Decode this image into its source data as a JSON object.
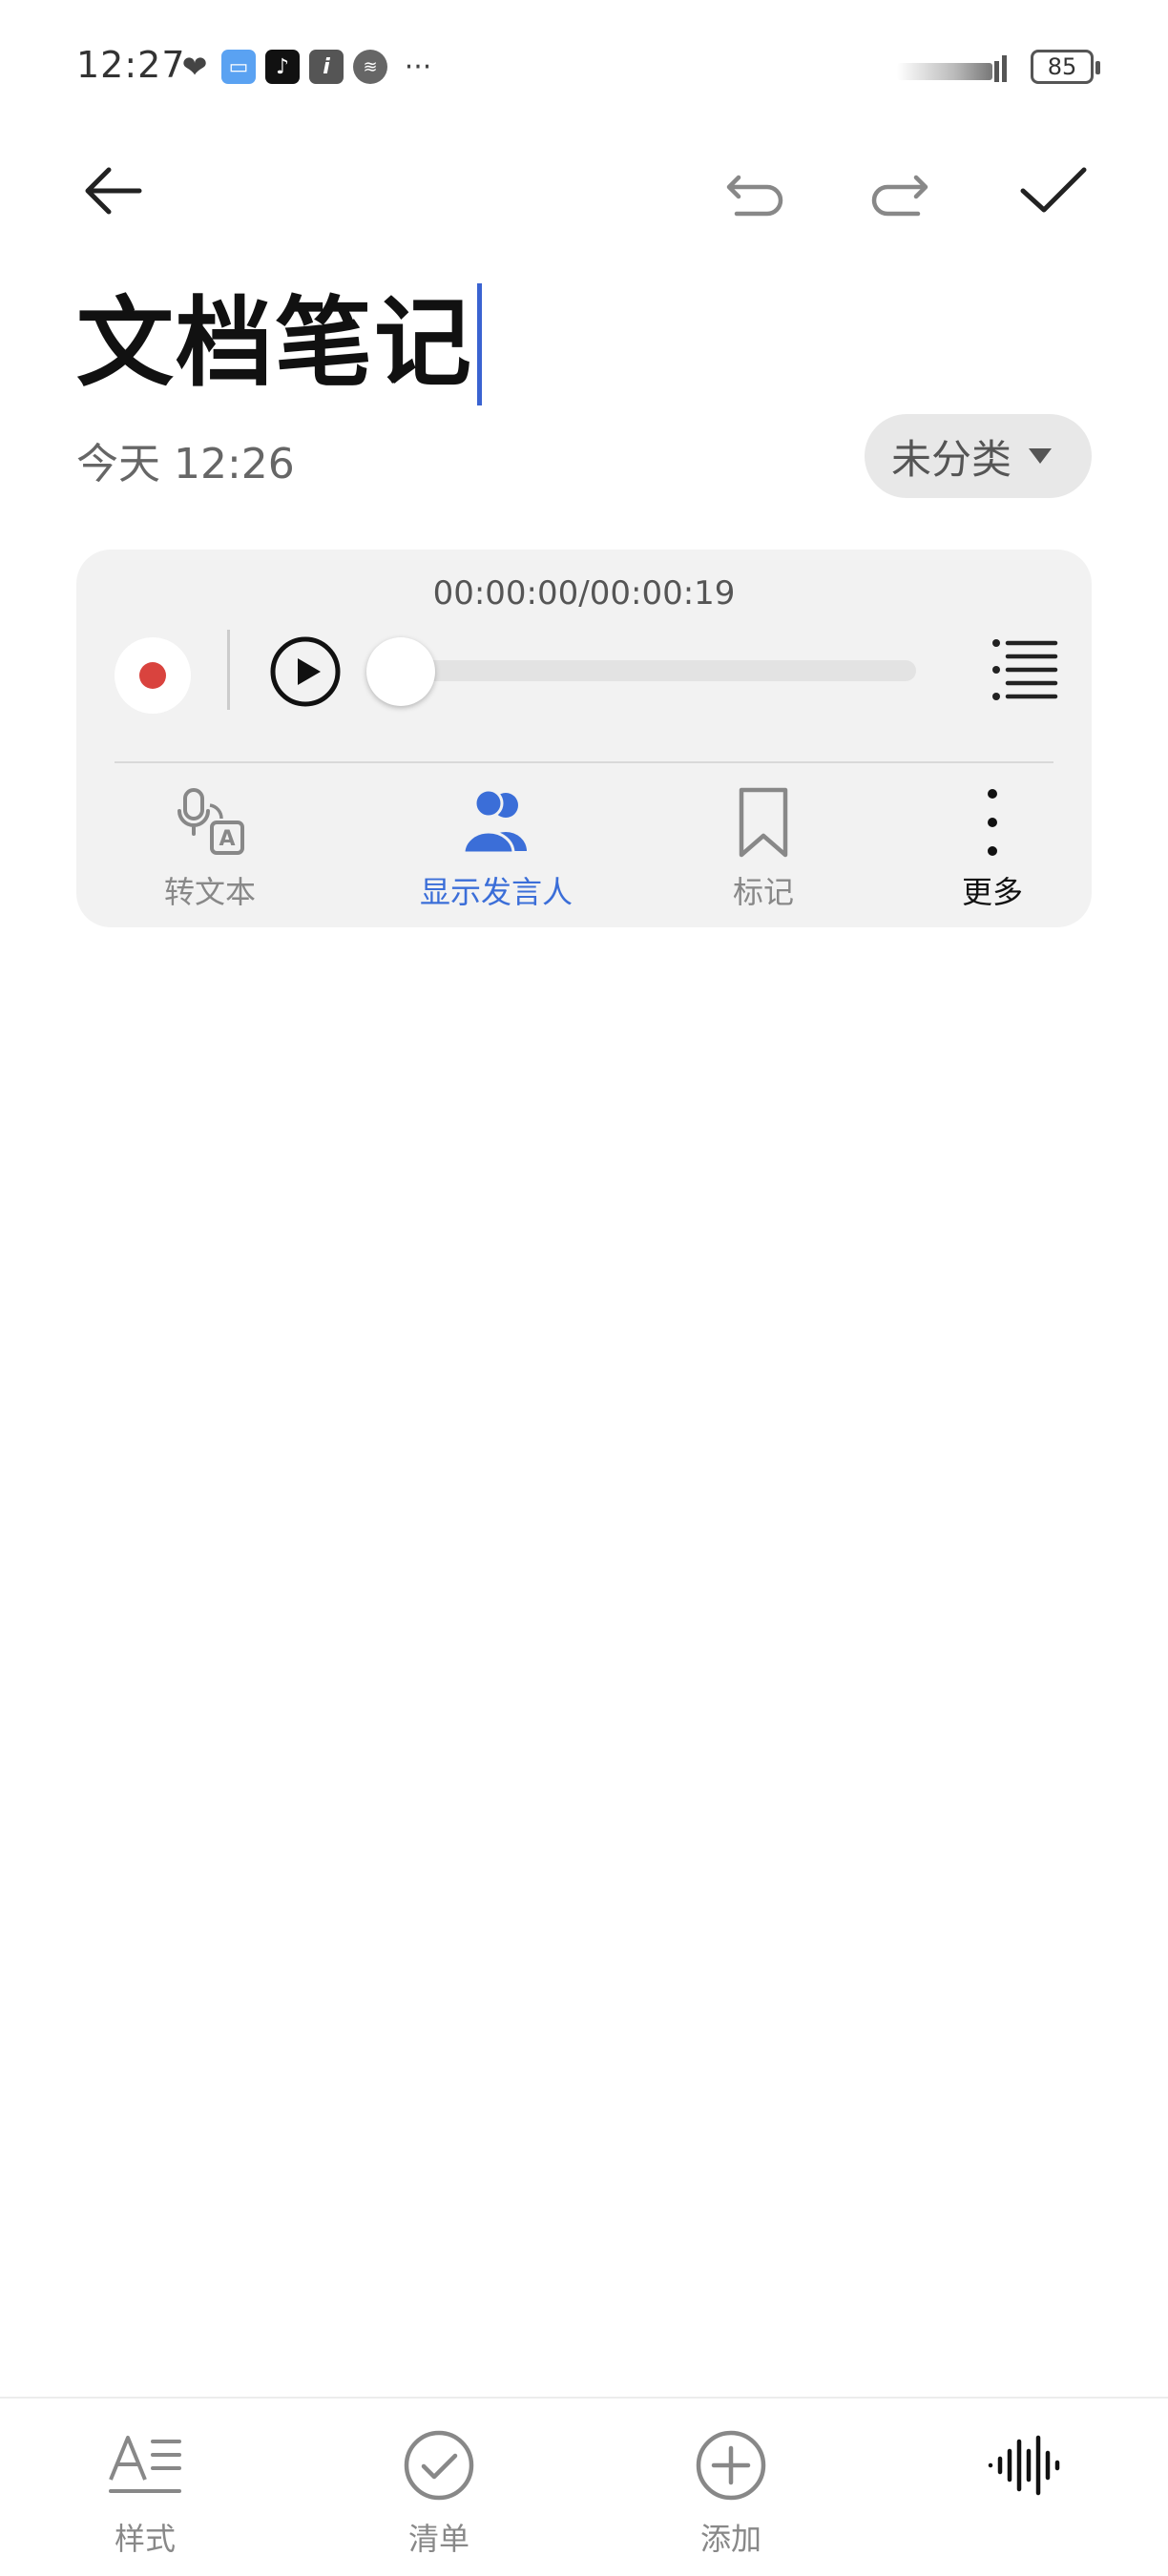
{
  "status_bar": {
    "time": "12:27",
    "battery": "85",
    "icons": [
      "heart-icon",
      "app-store-icon",
      "tiktok-icon",
      "info-icon",
      "audio-app-icon",
      "more-dots-icon"
    ]
  },
  "toolbar": {
    "back": "back-arrow-icon",
    "undo": "undo-icon",
    "redo": "redo-icon",
    "done": "checkmark-icon"
  },
  "note": {
    "title": "文档笔记",
    "date": "今天 12:26",
    "category": "未分类"
  },
  "audio_player": {
    "time_display": "00:00:00/00:00:19",
    "progress": 0,
    "actions": [
      {
        "label": "转文本",
        "icon": "speech-to-text-icon"
      },
      {
        "label": "显示发言人",
        "icon": "speakers-icon",
        "active": true
      },
      {
        "label": "标记",
        "icon": "bookmark-icon"
      },
      {
        "label": "更多",
        "icon": "more-vertical-icon"
      }
    ]
  },
  "bottom_bar": {
    "items": [
      {
        "label": "样式",
        "icon": "text-style-icon"
      },
      {
        "label": "清单",
        "icon": "checklist-icon"
      },
      {
        "label": "添加",
        "icon": "add-circle-icon"
      },
      {
        "label": "",
        "icon": "audio-waveform-icon"
      }
    ]
  },
  "colors": {
    "accent": "#3b6ed8",
    "record": "#d9433e",
    "card_bg": "#f2f2f2"
  }
}
